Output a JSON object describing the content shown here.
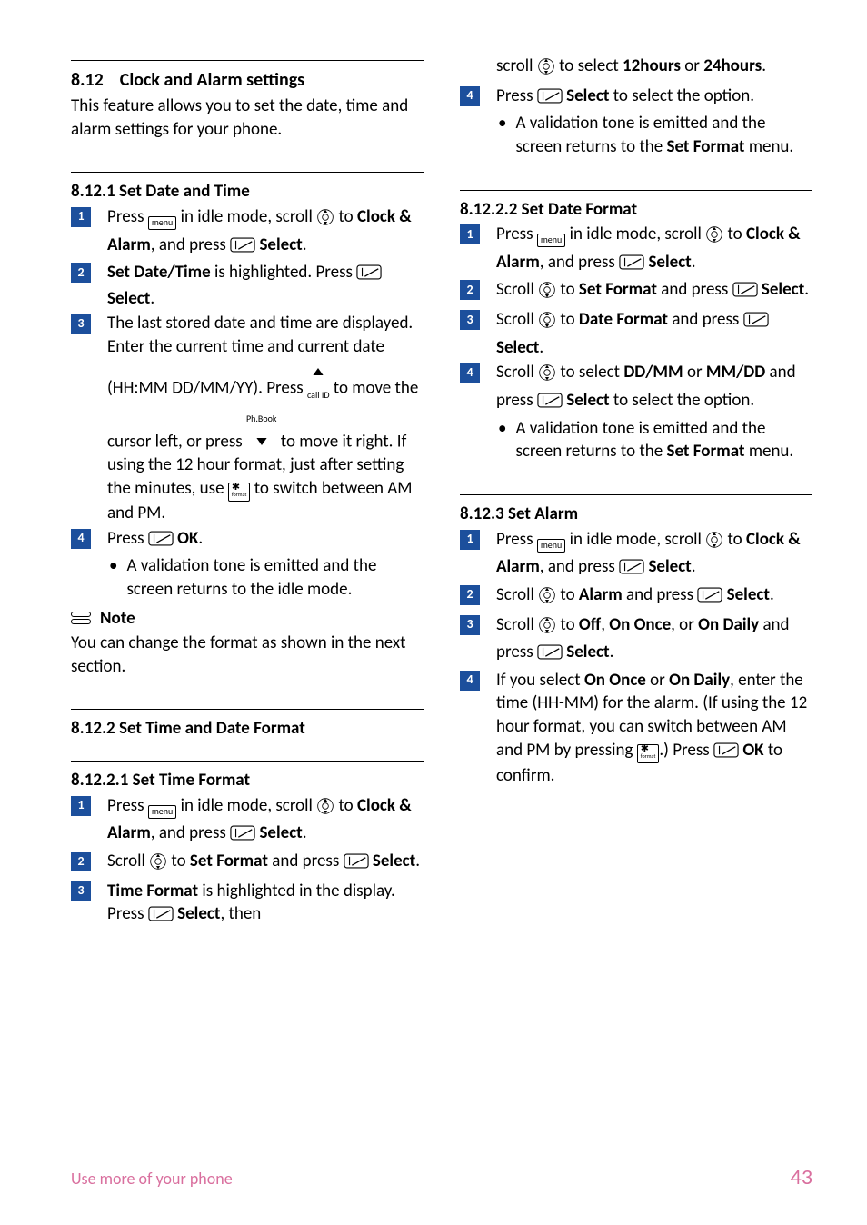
{
  "left": {
    "sec1_num": "8.12",
    "sec1_title": "Clock and Alarm settings",
    "sec1_intro": "This feature allows you to set the date, time and alarm settings for your phone.",
    "sub1_num": "8.12.1",
    "sub1_title": "Set Date and Time",
    "s1_a": "Press ",
    "s1_b": " in idle mode, scroll ",
    "s1_c": " to ",
    "s1_item": "Clock & Alarm",
    "s1_d": ", and press ",
    "s1_e": "Select",
    "s1_f": ".",
    "s2_item": "Set Date/Time",
    "s2_a": " is highlighted. Press ",
    "s2_b": "Select",
    "s2_c": ".",
    "s3_a": "The last stored date and time are displayed. Enter the current time and current date (HH:MM DD/MM/YY). Press ",
    "s3_b": " to move the cursor left, or press ",
    "s3_c": " to move it right. If using the 12 hour format, just after setting the minutes, use ",
    "s3_d": " to switch between AM and PM.",
    "s3_callid": "call ID",
    "s3_phbook": "Ph.Book",
    "s4_a": "Press ",
    "s4_b": "OK",
    "s4_c": ".",
    "s4_bullet": "A validation tone is emitted and the screen returns to the idle mode.",
    "note_label": "Note",
    "note_text": "You can change the format as shown in the next section.",
    "sub2_num": "8.12.2",
    "sub2_title": "Set Time and Date Format",
    "sub3_num": "8.12.2.1",
    "sub3_title": "Set Time Format",
    "t1_a": "Press ",
    "t1_b": " in idle mode, scroll ",
    "t1_c": " to ",
    "t1_item": "Clock & Alarm",
    "t1_d": ", and press ",
    "t1_e": "Select",
    "t1_f": ".",
    "t2_a": "Scroll ",
    "t2_b": " to ",
    "t2_item": "Set Format",
    "t2_c": " and press ",
    "t2_d": "Select",
    "t2_e": ".",
    "t3_item": "Time Format",
    "t3_a": " is highlighted in the display. Press ",
    "t3_b": "Select",
    "t3_c": ", then"
  },
  "right": {
    "r_top_a": "scroll ",
    "r_top_b": " to select ",
    "r_top_opt1": "12hours",
    "r_top_c": " or ",
    "r_top_opt2": "24hours",
    "r_top_d": ".",
    "r4_a": "Press ",
    "r4_b": "Select",
    "r4_c": " to select the option.",
    "r4_bullet_a": "A validation tone is emitted and the screen returns to the ",
    "r4_bullet_b": "Set Format",
    "r4_bullet_c": " menu.",
    "sub4_num": "8.12.2.2",
    "sub4_title": "Set Date Format",
    "d1_a": "Press ",
    "d1_b": " in idle mode, scroll ",
    "d1_c": " to ",
    "d1_item": "Clock & Alarm",
    "d1_d": ", and press ",
    "d1_e": "Select",
    "d1_f": ".",
    "d2_a": "Scroll ",
    "d2_b": " to ",
    "d2_item": "Set Format",
    "d2_c": " and press ",
    "d2_d": "Select",
    "d2_e": ".",
    "d3_a": "Scroll ",
    "d3_b": " to ",
    "d3_item": "Date Format",
    "d3_c": " and press ",
    "d3_d": "Select",
    "d3_e": ".",
    "d4_a": "Scroll ",
    "d4_b": " to select ",
    "d4_opt1": "DD/MM",
    "d4_c": " or ",
    "d4_opt2": "MM/DD",
    "d4_d": " and press ",
    "d4_e": "Select",
    "d4_f": " to select the option.",
    "d4_bullet_a": "A validation tone is emitted and the screen returns to the ",
    "d4_bullet_b": "Set Format",
    "d4_bullet_c": " menu.",
    "sub5_num": "8.12.3",
    "sub5_title": "Set Alarm",
    "a1_a": "Press ",
    "a1_b": " in idle mode, scroll ",
    "a1_c": " to ",
    "a1_item": "Clock & Alarm",
    "a1_d": ", and press ",
    "a1_e": "Select",
    "a1_f": ".",
    "a2_a": "Scroll ",
    "a2_b": " to ",
    "a2_item": "Alarm",
    "a2_c": " and press ",
    "a2_d": "Select",
    "a2_e": ".",
    "a3_a": "Scroll ",
    "a3_b": " to ",
    "a3_opt1": "Off",
    "a3_c": ", ",
    "a3_opt2": "On Once",
    "a3_d": ", or ",
    "a3_opt3": "On Daily",
    "a3_e": " and press ",
    "a3_f": "Select",
    "a3_g": ".",
    "a4_a": "If you select ",
    "a4_opt1": "On Once",
    "a4_b": " or ",
    "a4_opt2": "On Daily",
    "a4_c": ", enter the time (HH-MM) for the alarm. (If using the 12 hour format, you can switch between AM and PM by pressing ",
    "a4_d": ".) Press ",
    "a4_e": "OK",
    "a4_f": " to confirm."
  },
  "icons": {
    "menu_label": "menu",
    "star_label": "✱",
    "star_sub": "format"
  },
  "footer": {
    "left": "Use more of your phone",
    "right": "43"
  }
}
